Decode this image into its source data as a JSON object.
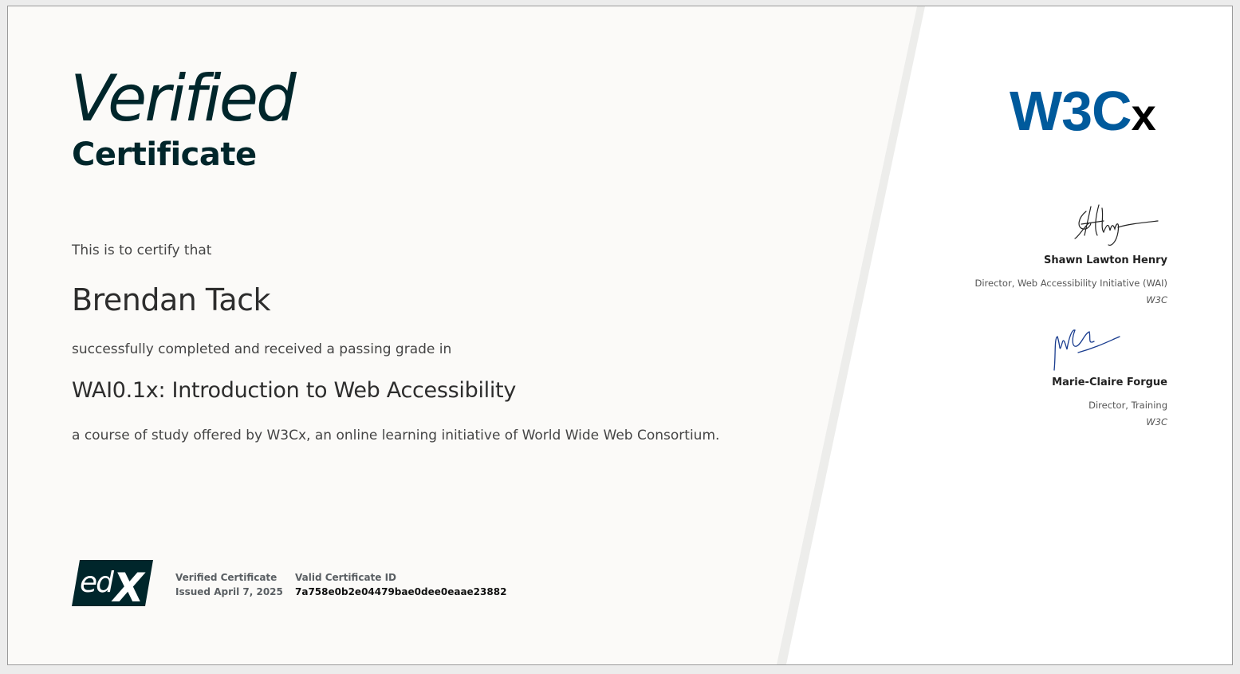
{
  "certificate": {
    "title_main": "Verified",
    "title_sub": "Certificate",
    "certify_intro": "This is to certify that",
    "recipient_name": "Brendan Tack",
    "completed_text": "successfully completed and received a passing grade in",
    "course_title": "WAI0.1x: Introduction to Web Accessibility",
    "offered_text": "a course of study offered by W3Cx, an online learning initiative of World Wide Web Consortium."
  },
  "footer": {
    "logo_text": "edX",
    "cert_type_label": "Verified Certificate",
    "issued_text": "Issued April 7, 2025",
    "cert_id_label": "Valid Certificate ID",
    "cert_id": "7a758e0b2e04479bae0dee0eaae23882"
  },
  "partner": {
    "logo_main": "W3C",
    "logo_suffix": "x"
  },
  "signatories": [
    {
      "name": "Shawn Lawton Henry",
      "title": "Director, Web Accessibility Initiative (WAI)",
      "organization": "W3C"
    },
    {
      "name": "Marie-Claire Forgue",
      "title": "Director, Training",
      "organization": "W3C"
    }
  ],
  "colors": {
    "brand_dark": "#00262b",
    "w3c_blue": "#005a9c",
    "signature_blue": "#1a3d8f"
  }
}
